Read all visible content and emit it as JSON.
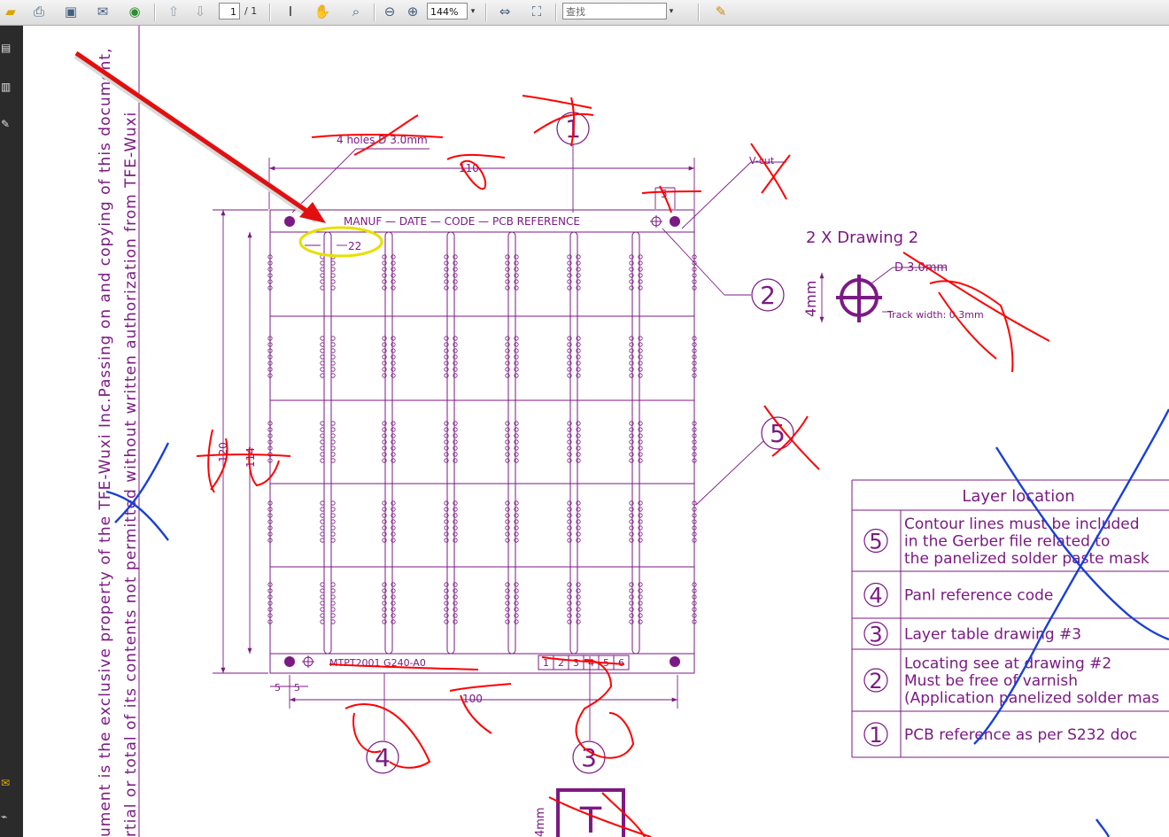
{
  "toolbar": {
    "page_current": "1",
    "page_total": "/ 1",
    "zoom": "144%",
    "search_placeholder": "查找"
  },
  "drawing": {
    "side_text_line1": "ument is the exclusive property of the TFE-Wuxi Inc.Passing on and copying of this document,",
    "side_text_line2": "rtial or total of its contents not permitted without written authorization from TFE-Wuxi",
    "label_holes": "4 holes D 3.0mm",
    "dim_110": "110",
    "dim_5_top": "5",
    "label_vcut": "V-cut",
    "header_text": "MANUF  — DATE — CODE — PCB REFERENCE",
    "dim_22": "22",
    "dim_120": "120",
    "dim_114": "114",
    "footer_code": "MTPT2001 G240-A0",
    "footer_boxes": [
      "1",
      "2",
      "3",
      "4",
      "5",
      "6"
    ],
    "dim_5a": "5",
    "dim_5b": "5",
    "dim_100": "100",
    "callout_1": "1",
    "callout_2": "2",
    "callout_3": "3",
    "callout_4": "4",
    "callout_5": "5",
    "drawing2_title": "2 X Drawing 2",
    "drawing2_dia": "D 3.0mm",
    "drawing2_4mm": "4mm",
    "drawing2_track": "Track width: 0.3mm",
    "bottom_dim": "4mm",
    "bottom_symbol": "T"
  },
  "layer_table": {
    "title": "Layer location",
    "rows": [
      {
        "num": "5",
        "lines": [
          "Contour lines must be included",
          "in the Gerber file related to",
          "the panelized solder paste mask"
        ]
      },
      {
        "num": "4",
        "lines": [
          "Panl reference code"
        ]
      },
      {
        "num": "3",
        "lines": [
          "Layer table drawing #3"
        ]
      },
      {
        "num": "2",
        "lines": [
          "Locating see at drawing #2",
          "Must be free of varnish",
          "(Application panelized solder mas"
        ]
      },
      {
        "num": "1",
        "lines": [
          "PCB reference as per S232 doc"
        ]
      }
    ]
  },
  "colors": {
    "drawing": "#7b1a83",
    "markup_red": "#ff0000",
    "markup_blue": "#1a3fd6",
    "highlight_yellow": "#e6e000"
  }
}
